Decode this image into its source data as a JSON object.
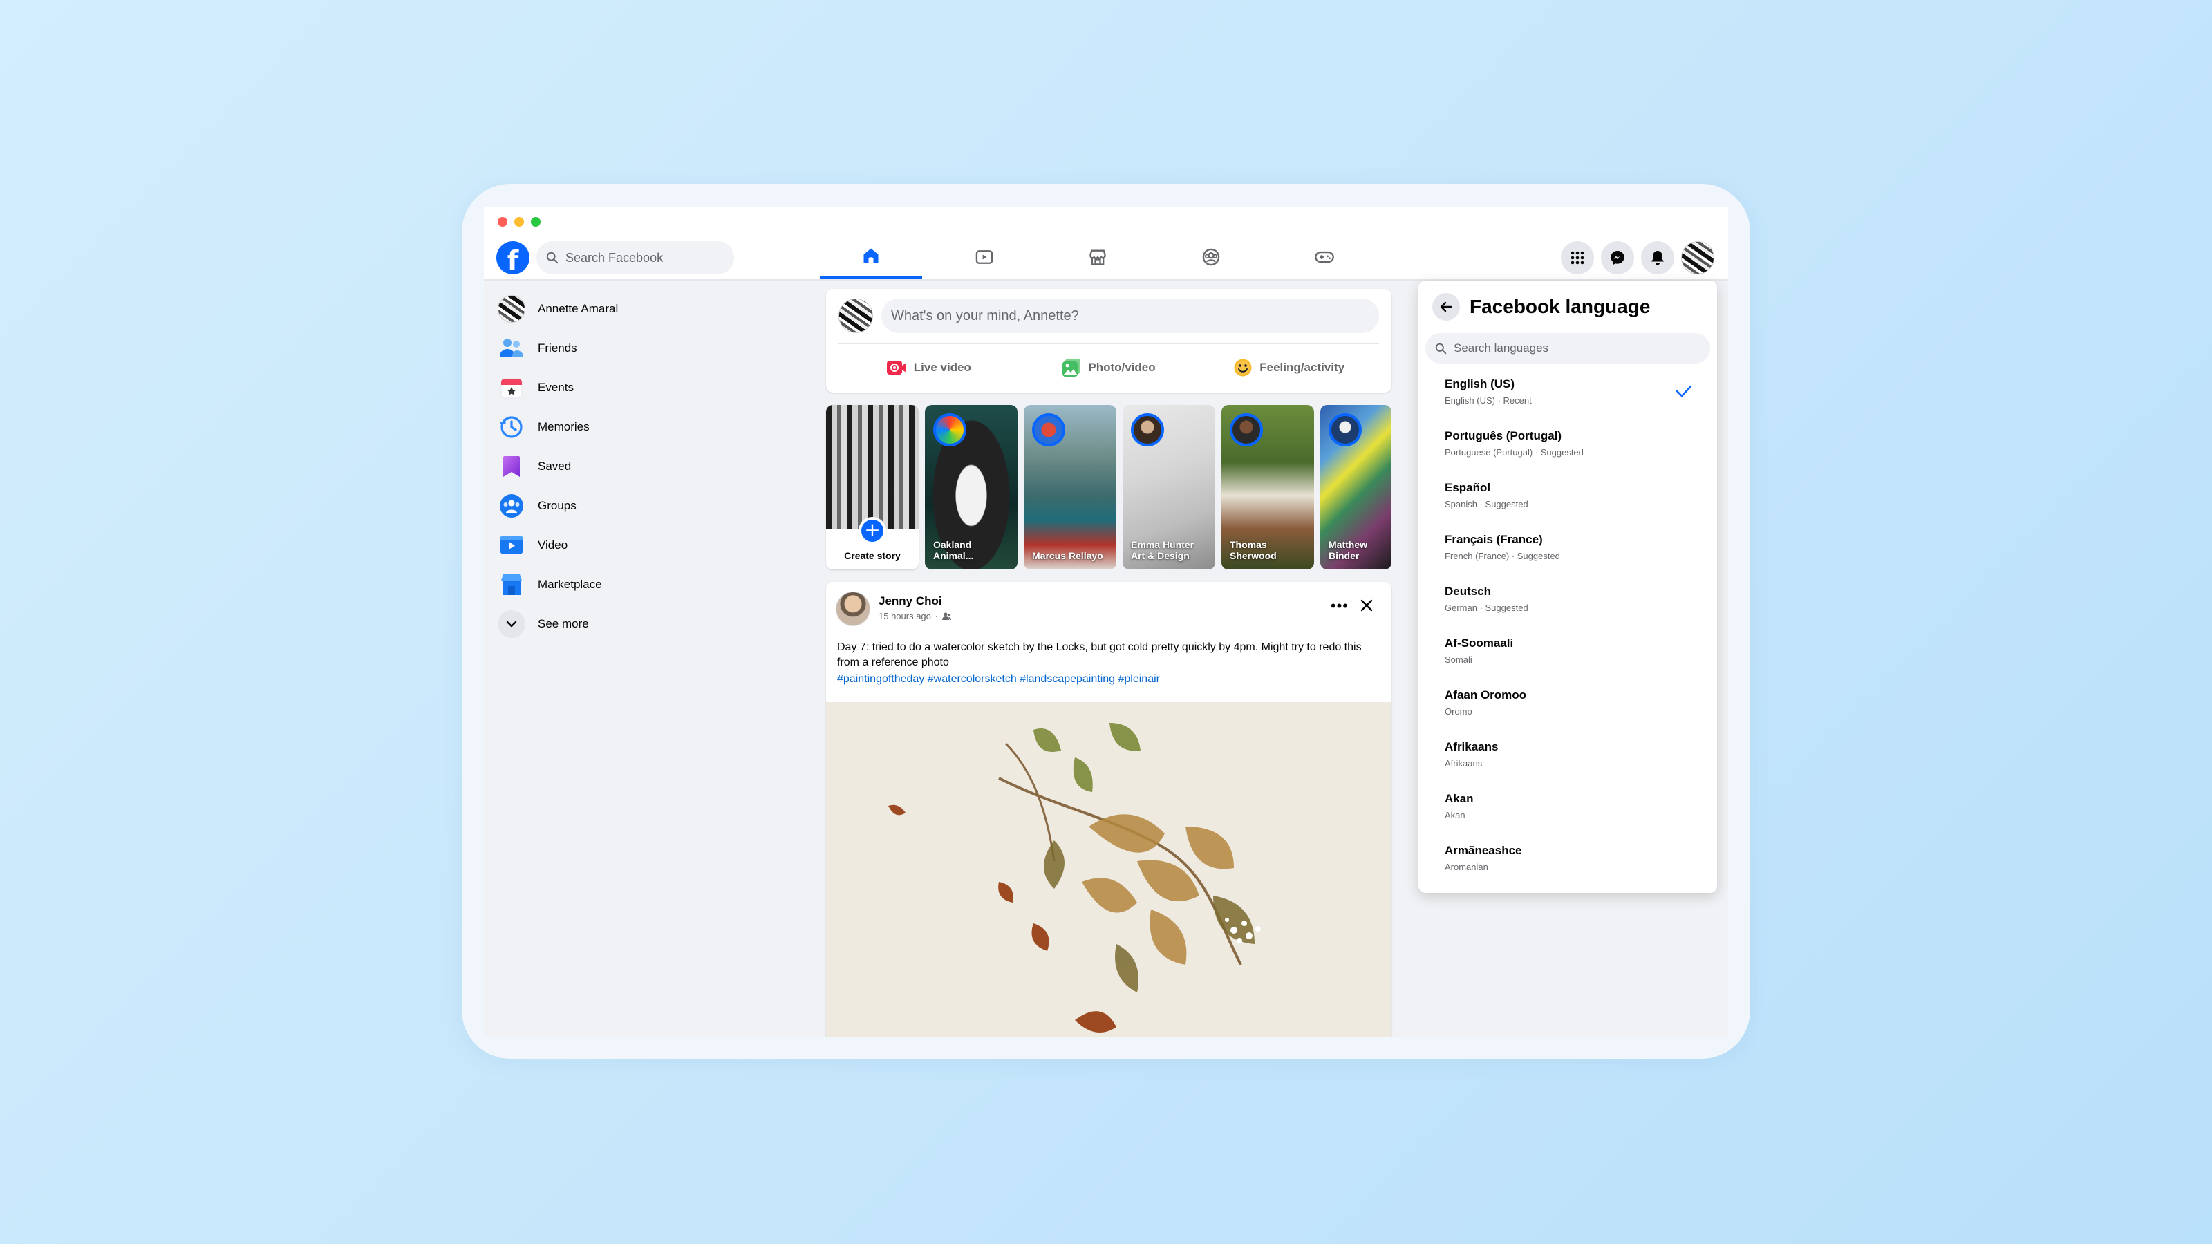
{
  "app": {
    "search_placeholder": "Search Facebook",
    "logo_letter": "f"
  },
  "nav_tabs": [
    {
      "name": "home",
      "active": true
    },
    {
      "name": "video"
    },
    {
      "name": "marketplace"
    },
    {
      "name": "groups"
    },
    {
      "name": "gaming"
    }
  ],
  "sidebar": {
    "items": [
      {
        "label": "Annette Amaral",
        "icon": "profile-avatar"
      },
      {
        "label": "Friends",
        "icon": "friends-icon"
      },
      {
        "label": "Events",
        "icon": "events-icon"
      },
      {
        "label": "Memories",
        "icon": "memories-icon"
      },
      {
        "label": "Saved",
        "icon": "saved-icon"
      },
      {
        "label": "Groups",
        "icon": "groups-icon"
      },
      {
        "label": "Video",
        "icon": "video-icon"
      },
      {
        "label": "Marketplace",
        "icon": "marketplace-icon"
      },
      {
        "label": "See more",
        "icon": "chevron-down-icon"
      }
    ]
  },
  "composer": {
    "placeholder": "What's on your mind, Annette?",
    "actions": [
      {
        "label": "Live video",
        "color": "#f02849"
      },
      {
        "label": "Photo/video",
        "color": "#45bd62"
      },
      {
        "label": "Feeling/activity",
        "color": "#f7b928"
      }
    ]
  },
  "stories": {
    "create_label": "Create story",
    "items": [
      {
        "name": "Oakland Animal..."
      },
      {
        "name": "Marcus Rellayo"
      },
      {
        "name": "Emma Hunter Art & Design"
      },
      {
        "name": "Thomas Sherwood"
      },
      {
        "name": "Matthew Binder"
      }
    ]
  },
  "post": {
    "author": "Jenny Choi",
    "time": "15 hours ago",
    "audience_icon": "friends-icon",
    "text": "Day 7: tried to do a watercolor sketch by the Locks, but got cold pretty quickly by 4pm. Might try to redo this from a reference photo",
    "hashtags": "#paintingoftheday #watercolorsketch #landscapepainting #pleinair",
    "more_label": "•••"
  },
  "language_panel": {
    "title": "Facebook language",
    "search_placeholder": "Search languages",
    "languages": [
      {
        "name": "English (US)",
        "sub": "English (US) · Recent",
        "selected": true
      },
      {
        "name": "Português (Portugal)",
        "sub": "Portuguese (Portugal) · Suggested"
      },
      {
        "name": "Español",
        "sub": "Spanish · Suggested"
      },
      {
        "name": "Français (France)",
        "sub": "French (France) · Suggested"
      },
      {
        "name": "Deutsch",
        "sub": "German · Suggested"
      },
      {
        "name": "Af-Soomaali",
        "sub": "Somali"
      },
      {
        "name": "Afaan Oromoo",
        "sub": "Oromo"
      },
      {
        "name": "Afrikaans",
        "sub": "Afrikaans"
      },
      {
        "name": "Akan",
        "sub": "Akan"
      },
      {
        "name": "Armãneashce",
        "sub": "Aromanian"
      }
    ]
  },
  "colors": {
    "accent": "#0866ff",
    "link": "#0064d1",
    "page_background": "#f0f2f5"
  }
}
